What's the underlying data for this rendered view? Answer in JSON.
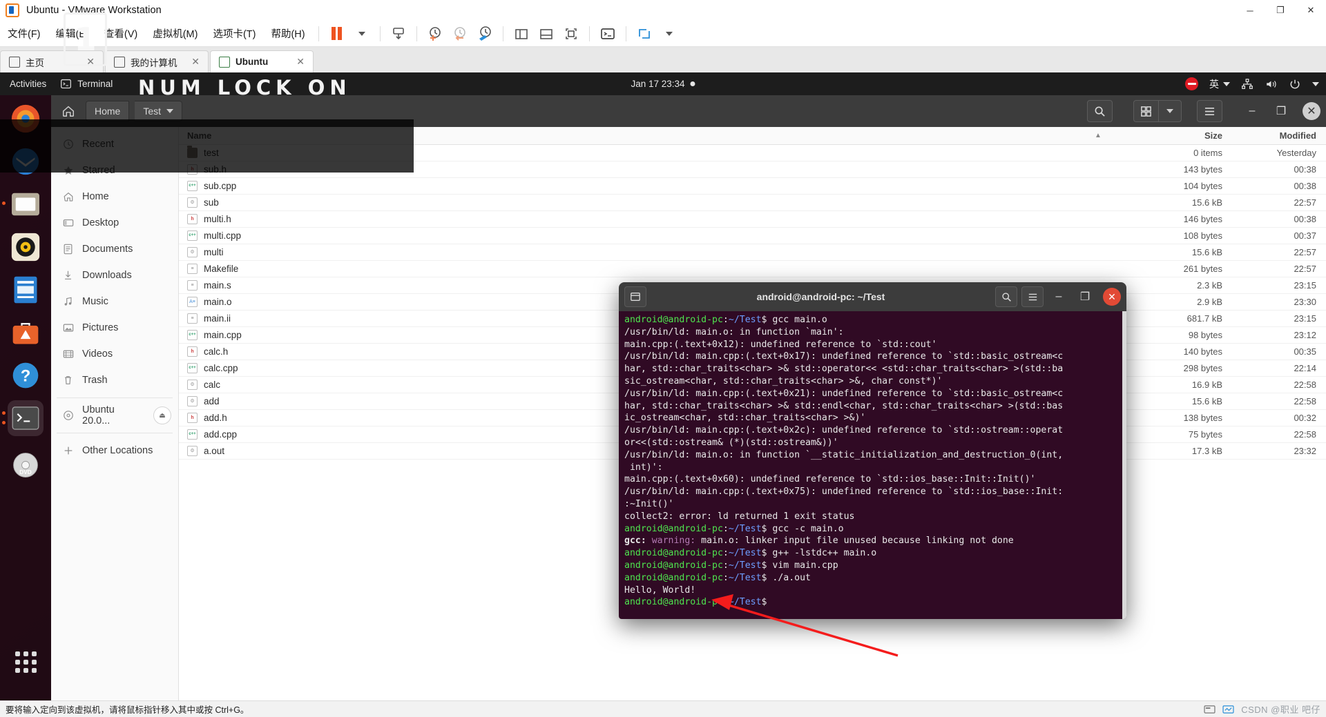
{
  "vmware": {
    "title": "Ubuntu - VMware Workstation",
    "window_controls": [
      {
        "name": "minimize",
        "glyph": "─"
      },
      {
        "name": "maximize",
        "glyph": "❐"
      },
      {
        "name": "close",
        "glyph": "✕"
      }
    ],
    "menus": [
      {
        "label": "文件(F)",
        "mnemonic": "F"
      },
      {
        "label": "编辑(E)",
        "mnemonic": "E"
      },
      {
        "label": "查看(V)",
        "mnemonic": "V"
      },
      {
        "label": "虚拟机(M)",
        "mnemonic": "M"
      },
      {
        "label": "选项卡(T)",
        "mnemonic": "T"
      },
      {
        "label": "帮助(H)",
        "mnemonic": "H"
      }
    ],
    "toolbar_icons": [
      "pause-icon",
      "dropdown-caret-icon",
      "send-ctrl-alt-del-icon",
      "snapshot-take-icon",
      "snapshot-revert-icon",
      "snapshot-manager-icon",
      "show-left-pane-icon",
      "show-bottom-pane-icon",
      "fullscreen-icon",
      "console-view-icon",
      "unity-mode-icon"
    ],
    "tabs": [
      {
        "label": "主页",
        "icon": "home-icon",
        "active": false
      },
      {
        "label": "我的计算机",
        "icon": "my-computer-icon",
        "active": false
      },
      {
        "label": "Ubuntu",
        "icon": "virtual-machine-icon",
        "active": true
      }
    ],
    "statusbar": {
      "hint": "要将输入定向到该虚拟机，请将鼠标指针移入其中或按 Ctrl+G。",
      "watermark": "CSDN @职业 吧仔"
    }
  },
  "numlock_overlay": {
    "key": "1",
    "message": "NUM LOCK ON"
  },
  "ubuntu_panel": {
    "activities": "Activities",
    "app_name": "Terminal",
    "clock": "Jan 17  23:34",
    "tray": {
      "recording_icon": "screen-recording-icon",
      "ime": "英",
      "network_icon": "network-icon",
      "volume_icon": "volume-icon",
      "power_icon": "power-icon",
      "menu_caret": "chevron-down-icon"
    }
  },
  "dock": {
    "items": [
      {
        "name": "firefox",
        "color": "#e8552a",
        "running": false
      },
      {
        "name": "thunderbird",
        "color": "#2b7fd4",
        "running": false
      },
      {
        "name": "files",
        "color": "#b5ac9a",
        "running": true
      },
      {
        "name": "rhythmbox",
        "color": "#efe7d4",
        "running": false
      },
      {
        "name": "libreoffice-writer",
        "color": "#2a7fd0",
        "running": false
      },
      {
        "name": "ubuntu-software",
        "color": "#e8622a",
        "running": false
      },
      {
        "name": "help",
        "color": "#2f8fd8",
        "running": false
      },
      {
        "name": "terminal",
        "color": "#3c3c3c",
        "running": true
      },
      {
        "name": "dvd-drive",
        "color": "#cfcfcf",
        "running": false
      }
    ],
    "show_apps": "show-applications-icon"
  },
  "nautilus": {
    "breadcrumbs": [
      {
        "label": "Home",
        "has_dropdown": false
      },
      {
        "label": "Test",
        "has_dropdown": true
      }
    ],
    "home_icon": "home-icon",
    "search_icon": "search-icon",
    "view_grid_icon": "grid-view-icon",
    "view_caret_icon": "chevron-down-icon",
    "menu_icon": "hamburger-menu-icon",
    "window_buttons": [
      {
        "name": "minimize",
        "glyph": "–"
      },
      {
        "name": "restore",
        "glyph": "❐"
      },
      {
        "name": "close",
        "glyph": "✕"
      }
    ],
    "sidebar": [
      {
        "label": "Recent",
        "icon": "clock-icon"
      },
      {
        "label": "Starred",
        "icon": "star-icon"
      },
      {
        "label": "Home",
        "icon": "home-icon"
      },
      {
        "label": "Desktop",
        "icon": "desktop-icon"
      },
      {
        "label": "Documents",
        "icon": "documents-icon"
      },
      {
        "label": "Downloads",
        "icon": "downloads-icon"
      },
      {
        "label": "Music",
        "icon": "music-icon"
      },
      {
        "label": "Pictures",
        "icon": "pictures-icon"
      },
      {
        "label": "Videos",
        "icon": "videos-icon"
      },
      {
        "label": "Trash",
        "icon": "trash-icon"
      }
    ],
    "sidebar_devices": [
      {
        "label": "Ubuntu 20.0...",
        "icon": "disc-icon",
        "eject": "eject-icon"
      }
    ],
    "sidebar_other": {
      "label": "Other Locations",
      "icon": "plus-icon"
    },
    "columns": {
      "name": "Name",
      "size": "Size",
      "modified": "Modified",
      "sort_arrow": "sort-ascending-icon"
    },
    "files": [
      {
        "name": "test",
        "kind": "folder",
        "size": "0 items",
        "modified": "Yesterday"
      },
      {
        "name": "sub.h",
        "kind": "h",
        "size": "143 bytes",
        "modified": "00:38"
      },
      {
        "name": "sub.cpp",
        "kind": "cpp",
        "size": "104 bytes",
        "modified": "00:38"
      },
      {
        "name": "sub",
        "kind": "exe",
        "size": "15.6 kB",
        "modified": "22:57"
      },
      {
        "name": "multi.h",
        "kind": "h",
        "size": "146 bytes",
        "modified": "00:38"
      },
      {
        "name": "multi.cpp",
        "kind": "cpp",
        "size": "108 bytes",
        "modified": "00:37"
      },
      {
        "name": "multi",
        "kind": "exe",
        "size": "15.6 kB",
        "modified": "22:57"
      },
      {
        "name": "Makefile",
        "kind": "txt",
        "size": "261 bytes",
        "modified": "22:57"
      },
      {
        "name": "main.s",
        "kind": "txt",
        "size": "2.3 kB",
        "modified": "23:15"
      },
      {
        "name": "main.o",
        "kind": "obj",
        "size": "2.9 kB",
        "modified": "23:30"
      },
      {
        "name": "main.ii",
        "kind": "txt",
        "size": "681.7 kB",
        "modified": "23:15"
      },
      {
        "name": "main.cpp",
        "kind": "cpp",
        "size": "98 bytes",
        "modified": "23:12"
      },
      {
        "name": "calc.h",
        "kind": "h",
        "size": "140 bytes",
        "modified": "00:35"
      },
      {
        "name": "calc.cpp",
        "kind": "cpp",
        "size": "298 bytes",
        "modified": "22:14"
      },
      {
        "name": "calc",
        "kind": "exe",
        "size": "16.9 kB",
        "modified": "22:58"
      },
      {
        "name": "add",
        "kind": "exe",
        "size": "15.6 kB",
        "modified": "22:58"
      },
      {
        "name": "add.h",
        "kind": "h",
        "size": "138 bytes",
        "modified": "00:32"
      },
      {
        "name": "add.cpp",
        "kind": "cpp",
        "size": "75 bytes",
        "modified": "22:58"
      },
      {
        "name": "a.out",
        "kind": "exe",
        "size": "17.3 kB",
        "modified": "23:32"
      }
    ]
  },
  "terminal": {
    "title": "android@android-pc: ~/Test",
    "buttons": {
      "new_tab_icon": "new-tab-icon",
      "search_icon": "search-icon",
      "menu_icon": "hamburger-menu-icon",
      "minimize": "–",
      "maximize": "❐",
      "close": "✕"
    },
    "prompt_user": "android@android-pc",
    "prompt_path": "~/Test",
    "lines": [
      {
        "type": "prompt",
        "cmd": "gcc main.o"
      },
      {
        "type": "out",
        "text": "/usr/bin/ld: main.o: in function `main':"
      },
      {
        "type": "out",
        "text": "main.cpp:(.text+0x12): undefined reference to `std::cout'"
      },
      {
        "type": "out",
        "text": "/usr/bin/ld: main.cpp:(.text+0x17): undefined reference to `std::basic_ostream<c"
      },
      {
        "type": "out",
        "text": "har, std::char_traits<char> >& std::operator<< <std::char_traits<char> >(std::ba"
      },
      {
        "type": "out",
        "text": "sic_ostream<char, std::char_traits<char> >&, char const*)'"
      },
      {
        "type": "out",
        "text": "/usr/bin/ld: main.cpp:(.text+0x21): undefined reference to `std::basic_ostream<c"
      },
      {
        "type": "out",
        "text": "har, std::char_traits<char> >& std::endl<char, std::char_traits<char> >(std::bas"
      },
      {
        "type": "out",
        "text": "ic_ostream<char, std::char_traits<char> >&)'"
      },
      {
        "type": "out",
        "text": "/usr/bin/ld: main.cpp:(.text+0x2c): undefined reference to `std::ostream::operat"
      },
      {
        "type": "out",
        "text": "or<<(std::ostream& (*)(std::ostream&))'"
      },
      {
        "type": "out",
        "text": "/usr/bin/ld: main.o: in function `__static_initialization_and_destruction_0(int,"
      },
      {
        "type": "out",
        "text": " int)':"
      },
      {
        "type": "out",
        "text": "main.cpp:(.text+0x60): undefined reference to `std::ios_base::Init::Init()'"
      },
      {
        "type": "out",
        "text": "/usr/bin/ld: main.cpp:(.text+0x75): undefined reference to `std::ios_base::Init:"
      },
      {
        "type": "out",
        "text": ":~Init()'"
      },
      {
        "type": "out",
        "text": "collect2: error: ld returned 1 exit status"
      },
      {
        "type": "prompt",
        "cmd": "gcc -c main.o"
      },
      {
        "type": "warning",
        "prefix": "gcc:",
        "level": "warning:",
        "text": " main.o: linker input file unused because linking not done"
      },
      {
        "type": "prompt",
        "cmd": "g++ -lstdc++ main.o"
      },
      {
        "type": "prompt",
        "cmd": "vim main.cpp"
      },
      {
        "type": "prompt",
        "cmd": "./a.out"
      },
      {
        "type": "out",
        "text": "Hello, World!"
      },
      {
        "type": "prompt",
        "cmd": ""
      }
    ]
  },
  "colors": {
    "terminal_bg": "#300a24",
    "prompt_green": "#4ee44e",
    "prompt_blue": "#6d9eff",
    "accent_orange": "#e95420",
    "arrow_red": "#f41c1c"
  }
}
